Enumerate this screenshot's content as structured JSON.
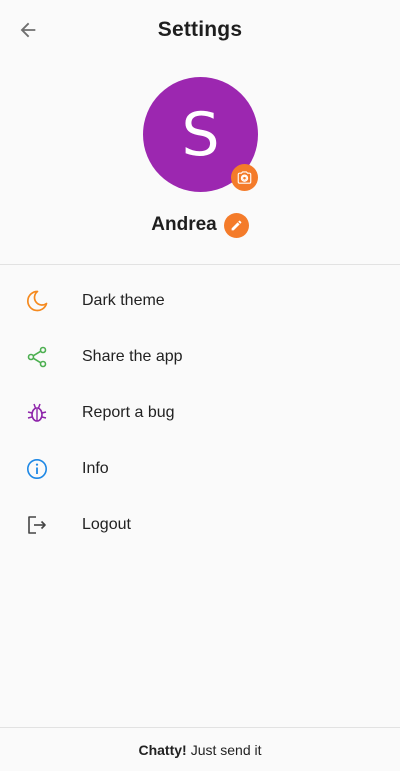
{
  "header": {
    "title": "Settings",
    "back_icon": "arrow-back-icon"
  },
  "profile": {
    "avatar_letter": "S",
    "avatar_color": "#9c27b0",
    "name": "Andrea",
    "accent_color": "#f47b2a"
  },
  "menu": {
    "items": [
      {
        "label": "Dark theme",
        "icon": "moon-icon",
        "color": "#f58a1f"
      },
      {
        "label": "Share the app",
        "icon": "share-icon",
        "color": "#4caf50"
      },
      {
        "label": "Report a bug",
        "icon": "bug-icon",
        "color": "#8e24aa"
      },
      {
        "label": "Info",
        "icon": "info-icon",
        "color": "#1e88e5"
      },
      {
        "label": "Logout",
        "icon": "logout-icon",
        "color": "#444444"
      }
    ]
  },
  "footer": {
    "brand": "Chatty!",
    "tagline": "Just send it"
  }
}
